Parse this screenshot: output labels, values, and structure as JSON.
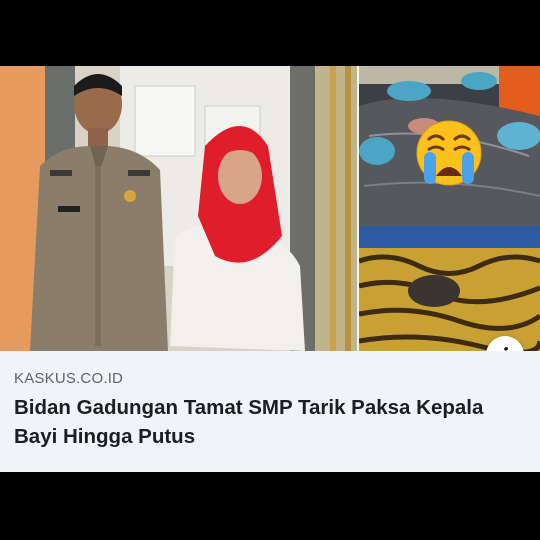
{
  "post": {
    "source": "KASKUS.CO.ID",
    "headline": "Bidan Gadungan Tamat SMP Tarik Paksa Kepala Bayi Hingga Putus",
    "info_icon": "info-icon",
    "crying_emoji": "loudly-crying-face-emoji"
  },
  "colors": {
    "background": "#000000",
    "caption_bg": "#f2f3f5",
    "headline": "#1c1e21",
    "source": "#5f6368",
    "hijab_red": "#e01e2b",
    "uniform": "#8b7e68"
  }
}
